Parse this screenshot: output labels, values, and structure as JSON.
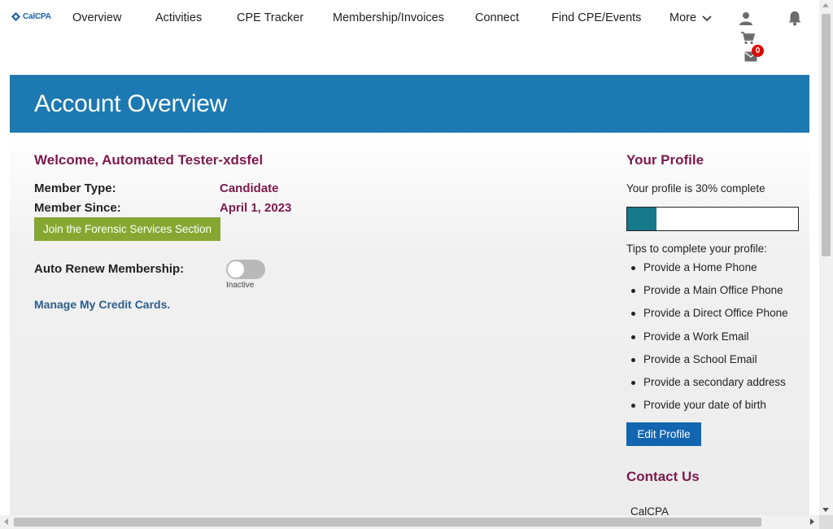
{
  "brand": {
    "logo_text": "CalCPA"
  },
  "nav": {
    "items": [
      {
        "label": "Overview"
      },
      {
        "label": "Activities"
      },
      {
        "label": "CPE Tracker"
      },
      {
        "label": "Membership/Invoices"
      },
      {
        "label": "Connect"
      },
      {
        "label": "Find CPE/Events"
      },
      {
        "label": "More"
      }
    ],
    "cart_count": "0",
    "icons": [
      "user-icon",
      "bell-icon",
      "cart-icon",
      "mail-icon",
      "chevron-down-icon"
    ]
  },
  "banner": {
    "title": "Account Overview"
  },
  "account": {
    "welcome": "Welcome, Automated Tester-xdsfel",
    "member_type_label": "Member Type:",
    "member_type_value": "Candidate",
    "member_since_label": "Member Since:",
    "member_since_value": "April 1, 2023",
    "join_button": "Join the Forensic Services Section",
    "auto_renew_label": "Auto Renew Membership:",
    "auto_renew_status": "Inactive",
    "manage_cards_link": "Manage My Credit Cards."
  },
  "profile": {
    "title": "Your Profile",
    "complete_text": "Your profile is 30% complete",
    "progress_percent": 30,
    "tips_label": "Tips to complete your profile:",
    "tips": [
      "Provide a Home Phone",
      "Provide a Main Office Phone",
      "Provide a Direct Office Phone",
      "Provide a Work Email",
      "Provide a School Email",
      "Provide a secondary address",
      "Provide your date of birth"
    ],
    "edit_button": "Edit Profile"
  },
  "contact": {
    "title": "Contact Us",
    "org": "CalCPA"
  },
  "colors": {
    "banner": "#1c79b1",
    "heading": "#7b1a4e",
    "join_button": "#86a832",
    "progress_fill": "#17798a",
    "edit_button": "#1265b0",
    "badge": "#e00000"
  }
}
